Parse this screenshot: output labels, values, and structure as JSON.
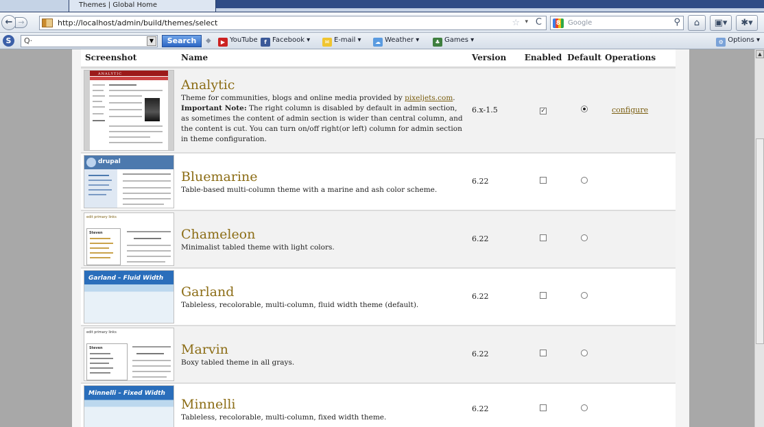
{
  "browser": {
    "tab_title": "Themes | Global Home",
    "url": "http://localhost/admin/build/themes/select",
    "search_placeholder": "Google",
    "toolbar": {
      "search_value": "Q·",
      "search_button": "Search",
      "links": [
        "YouTube",
        "Facebook ▾",
        "E-mail ▾",
        "Weather ▾",
        "Games ▾"
      ],
      "options": "Options ▾"
    }
  },
  "table": {
    "headers": [
      "Screenshot",
      "Name",
      "Version",
      "Enabled",
      "Default",
      "Operations"
    ]
  },
  "themes": [
    {
      "name": "Analytic",
      "desc_before_link": "Theme for communities, blogs and online media provided by ",
      "link": "pixeljets.com",
      "desc_after_link": ".",
      "note_label": "Important Note:",
      "note": " The right column is disabled by default in admin section, as sometimes the content of admin section is wider than central column, and the content is cut. You can turn on/off right(or left) column for admin section in theme configuration.",
      "version": "6.x-1.5",
      "enabled": true,
      "default": true,
      "operation": "configure"
    },
    {
      "name": "Bluemarine",
      "desc": "Table-based multi-column theme with a marine and ash color scheme.",
      "version": "6.22",
      "enabled": false,
      "default": false
    },
    {
      "name": "Chameleon",
      "desc": "Minimalist tabled theme with light colors.",
      "version": "6.22",
      "enabled": false,
      "default": false
    },
    {
      "name": "Garland",
      "desc": "Tableless, recolorable, multi-column, fluid width theme (default).",
      "version": "6.22",
      "enabled": false,
      "default": false
    },
    {
      "name": "Marvin",
      "desc": "Boxy tabled theme in all grays.",
      "version": "6.22",
      "enabled": false,
      "default": false
    },
    {
      "name": "Minnelli",
      "desc": "Tableless, recolorable, multi-column, fixed width theme.",
      "version": "6.22",
      "enabled": false,
      "default": false
    }
  ],
  "thumbnails": {
    "analytic_header": "ANALYTIC",
    "bluemarine_logo": "drupal",
    "chameleon_links": "edit primary links",
    "chameleon_user": "Steven",
    "marvin_links": "edit primary links",
    "marvin_user": "Steven",
    "garland_label": "Garland  –  Fluid Width",
    "minnelli_label": "Minnelli  –  Fixed Width"
  },
  "colors": {
    "theme_name": "#8c6d16",
    "row_odd": "#f2f2f2",
    "search_button": "#2e67c4"
  }
}
